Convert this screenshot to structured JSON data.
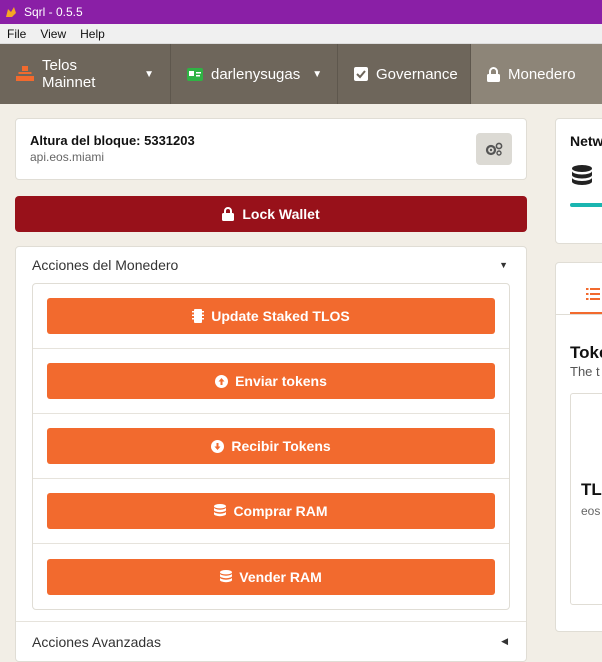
{
  "window": {
    "title": "Sqrl - 0.5.5"
  },
  "menu": {
    "file": "File",
    "view": "View",
    "help": "Help"
  },
  "nav": {
    "network": "Telos Mainnet",
    "account": "darlenysugas",
    "governance": "Governance",
    "wallet": "Monedero"
  },
  "block": {
    "height_label": "Altura del bloque: 5331203",
    "node": "api.eos.miami"
  },
  "lock_button": "Lock Wallet",
  "wallet_actions": {
    "header": "Acciones del Monedero",
    "buttons": [
      "Update Staked TLOS",
      "Enviar tokens",
      "Recibir Tokens",
      "Comprar RAM",
      "Vender RAM"
    ]
  },
  "advanced_actions": {
    "header": "Acciones Avanzadas"
  },
  "right_panel": {
    "network_title": "Netw",
    "tokens_title": "Toke",
    "tokens_subtitle": "The t",
    "token_symbol": "TL",
    "token_contract": "eos"
  },
  "colors": {
    "titlebar": "#8a1fa6",
    "nav": "#6e665b",
    "lock": "#98111a",
    "accent": "#f26a2e",
    "teal": "#1ab5b0"
  }
}
